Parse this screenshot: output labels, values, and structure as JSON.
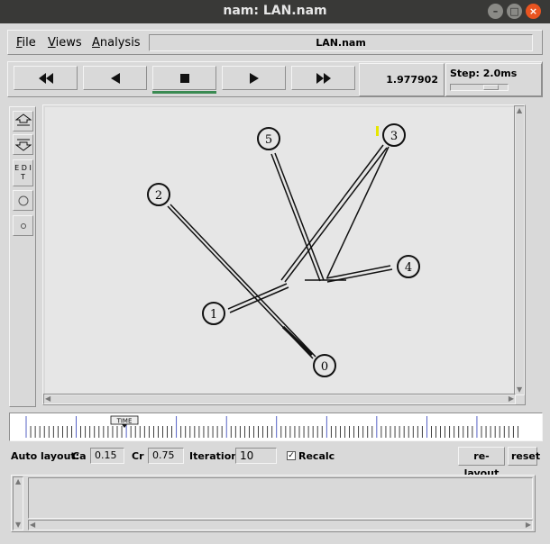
{
  "window": {
    "title": "nam: LAN.nam"
  },
  "menu": {
    "file": "File",
    "views": "Views",
    "analysis": "Analysis",
    "filename": "LAN.nam"
  },
  "playback": {
    "rewind_icon": "fast-rewind-icon",
    "back_icon": "play-backward-icon",
    "stop_icon": "stop-icon",
    "play_icon": "play-forward-icon",
    "ff_icon": "fast-forward-icon",
    "current_time": "1.977902",
    "step_label": "Step: 2.0ms"
  },
  "sidebar": {
    "edit_label": "E D I T"
  },
  "nodes": [
    {
      "id": "0",
      "label": "0"
    },
    {
      "id": "1",
      "label": "1"
    },
    {
      "id": "2",
      "label": "2"
    },
    {
      "id": "3",
      "label": "3"
    },
    {
      "id": "4",
      "label": "4"
    },
    {
      "id": "5",
      "label": "5"
    }
  ],
  "timeline": {
    "marker_label": "TIME"
  },
  "layout": {
    "auto_layout": "Auto layout:",
    "ca_label": "Ca",
    "ca_value": "0.15",
    "cr_label": "Cr",
    "cr_value": "0.75",
    "iterations_label": "Iterations",
    "iterations_value": "10",
    "recalc_label": "Recalc",
    "recalc_checked": true,
    "relayout_button": "re-layout",
    "reset_button": "reset"
  },
  "colors": {
    "titlebar": "#393937",
    "close": "#e95420",
    "active": "#3a8a52",
    "packet": "#e6e600"
  }
}
